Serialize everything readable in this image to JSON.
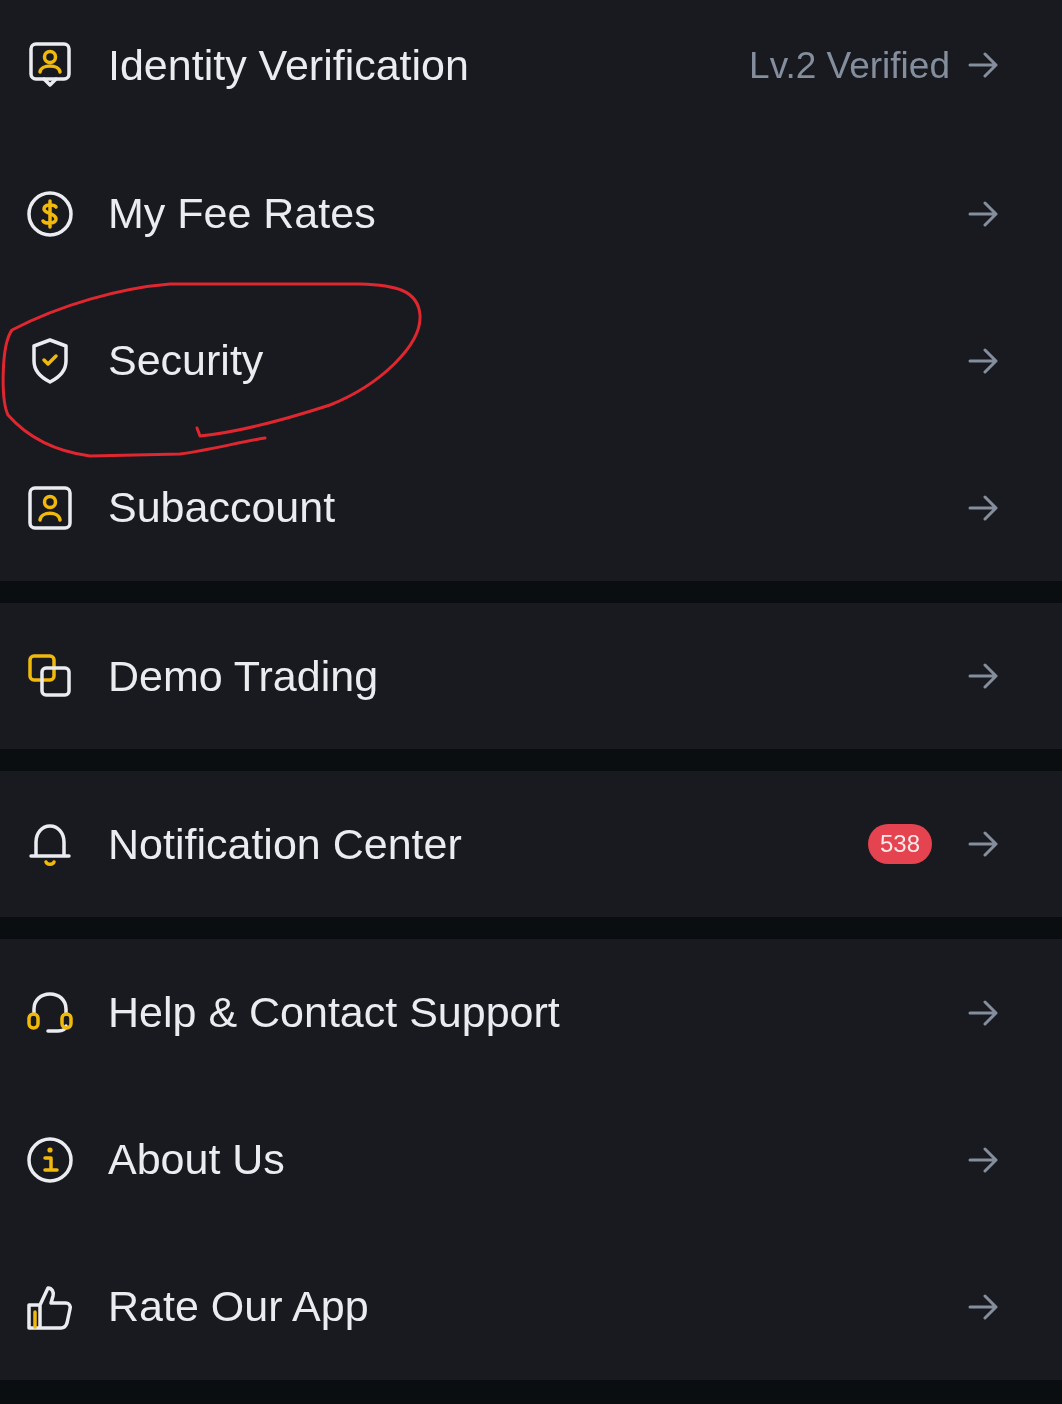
{
  "groups": [
    {
      "items": [
        {
          "label": "Identity Verification",
          "value": "Lv.2 Verified",
          "circled": false
        },
        {
          "label": "My Fee Rates",
          "circled": false
        },
        {
          "label": "Security",
          "circled": true
        },
        {
          "label": "Subaccount",
          "circled": false
        }
      ]
    },
    {
      "items": [
        {
          "label": "Demo Trading",
          "circled": false
        }
      ]
    },
    {
      "items": [
        {
          "label": "Notification Center",
          "badge": "538",
          "circled": false
        }
      ]
    },
    {
      "items": [
        {
          "label": "Help & Contact Support",
          "circled": false
        },
        {
          "label": "About Us",
          "circled": false
        },
        {
          "label": "Rate Our App",
          "circled": false
        }
      ]
    }
  ]
}
